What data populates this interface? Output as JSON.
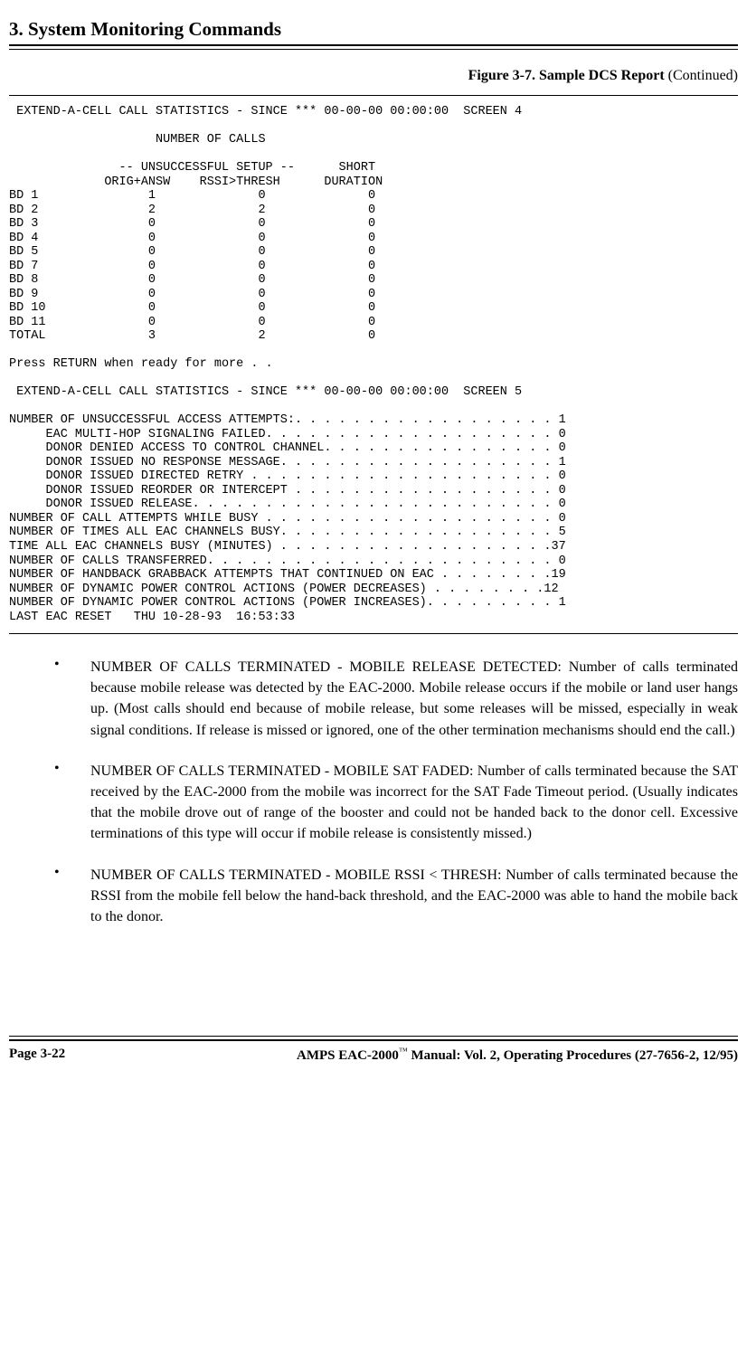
{
  "chapter": "3.  System Monitoring Commands",
  "figure": {
    "label": "Figure 3-7.  Sample DCS Report",
    "suffix": "  (Continued)"
  },
  "report": " EXTEND-A-CELL CALL STATISTICS - SINCE *** 00-00-00 00:00:00  SCREEN 4\n\n                    NUMBER OF CALLS\n\n               -- UNSUCCESSFUL SETUP --      SHORT\n             ORIG+ANSW    RSSI>THRESH      DURATION\nBD 1               1              0              0\nBD 2               2              2              0\nBD 3               0              0              0\nBD 4               0              0              0\nBD 5               0              0              0\nBD 7               0              0              0\nBD 8               0              0              0\nBD 9               0              0              0\nBD 10              0              0              0\nBD 11              0              0              0\nTOTAL              3              2              0\n\nPress RETURN when ready for more . .\n\n EXTEND-A-CELL CALL STATISTICS - SINCE *** 00-00-00 00:00:00  SCREEN 5\n\nNUMBER OF UNSUCCESSFUL ACCESS ATTEMPTS:. . . . . . . . . . . . . . . . . . 1\n     EAC MULTI-HOP SIGNALING FAILED. . . . . . . . . . . . . . . . . . . . 0\n     DONOR DENIED ACCESS TO CONTROL CHANNEL. . . . . . . . . . . . . . . . 0\n     DONOR ISSUED NO RESPONSE MESSAGE. . . . . . . . . . . . . . . . . . . 1\n     DONOR ISSUED DIRECTED RETRY . . . . . . . . . . . . . . . . . . . . . 0\n     DONOR ISSUED REORDER OR INTERCEPT . . . . . . . . . . . . . . . . . . 0\n     DONOR ISSUED RELEASE. . . . . . . . . . . . . . . . . . . . . . . . . 0\nNUMBER OF CALL ATTEMPTS WHILE BUSY . . . . . . . . . . . . . . . . . . . . 0\nNUMBER OF TIMES ALL EAC CHANNELS BUSY. . . . . . . . . . . . . . . . . . . 5\nTIME ALL EAC CHANNELS BUSY (MINUTES) . . . . . . . . . . . . . . . . . . .37\nNUMBER OF CALLS TRANSFERRED. . . . . . . . . . . . . . . . . . . . . . . . 0\nNUMBER OF HANDBACK GRABBACK ATTEMPTS THAT CONTINUED ON EAC . . . . . . . .19\nNUMBER OF DYNAMIC POWER CONTROL ACTIONS (POWER DECREASES) . . . . . . . .12\nNUMBER OF DYNAMIC POWER CONTROL ACTIONS (POWER INCREASES). . . . . . . . . 1\nLAST EAC RESET   THU 10-28-93  16:53:33",
  "bullets": [
    "NUMBER OF CALLS TERMINATED - MOBILE RELEASE DETECTED:  Number of calls terminated because mobile release was detected by the EAC-2000.  Mobile release occurs if the mobile or land user hangs up.  (Most calls should end because of mobile release, but some releases will be missed, especially in weak signal conditions.  If release is missed or ignored, one of the other termination mechanisms should end the call.)",
    "NUMBER OF CALLS TERMINATED - MOBILE SAT FADED:  Number of calls terminated because the SAT received by the EAC-2000 from the mobile was incorrect for the SAT Fade Timeout period.  (Usually indicates that the mobile drove out of range of the booster and could not be handed back to the donor cell.  Excessive terminations of this type will occur if mobile release is consistently missed.)",
    "NUMBER OF CALLS TERMINATED - MOBILE RSSI < THRESH:  Number of calls terminated because the RSSI from the mobile fell below the hand-back threshold, and the EAC-2000 was able to hand the mobile back to the donor."
  ],
  "footer": {
    "page": "Page 3-22",
    "manual_prefix": "AMPS EAC-2000",
    "manual_suffix": " Manual:  Vol. 2, Operating Procedures (27-7656-2, 12/95)"
  }
}
